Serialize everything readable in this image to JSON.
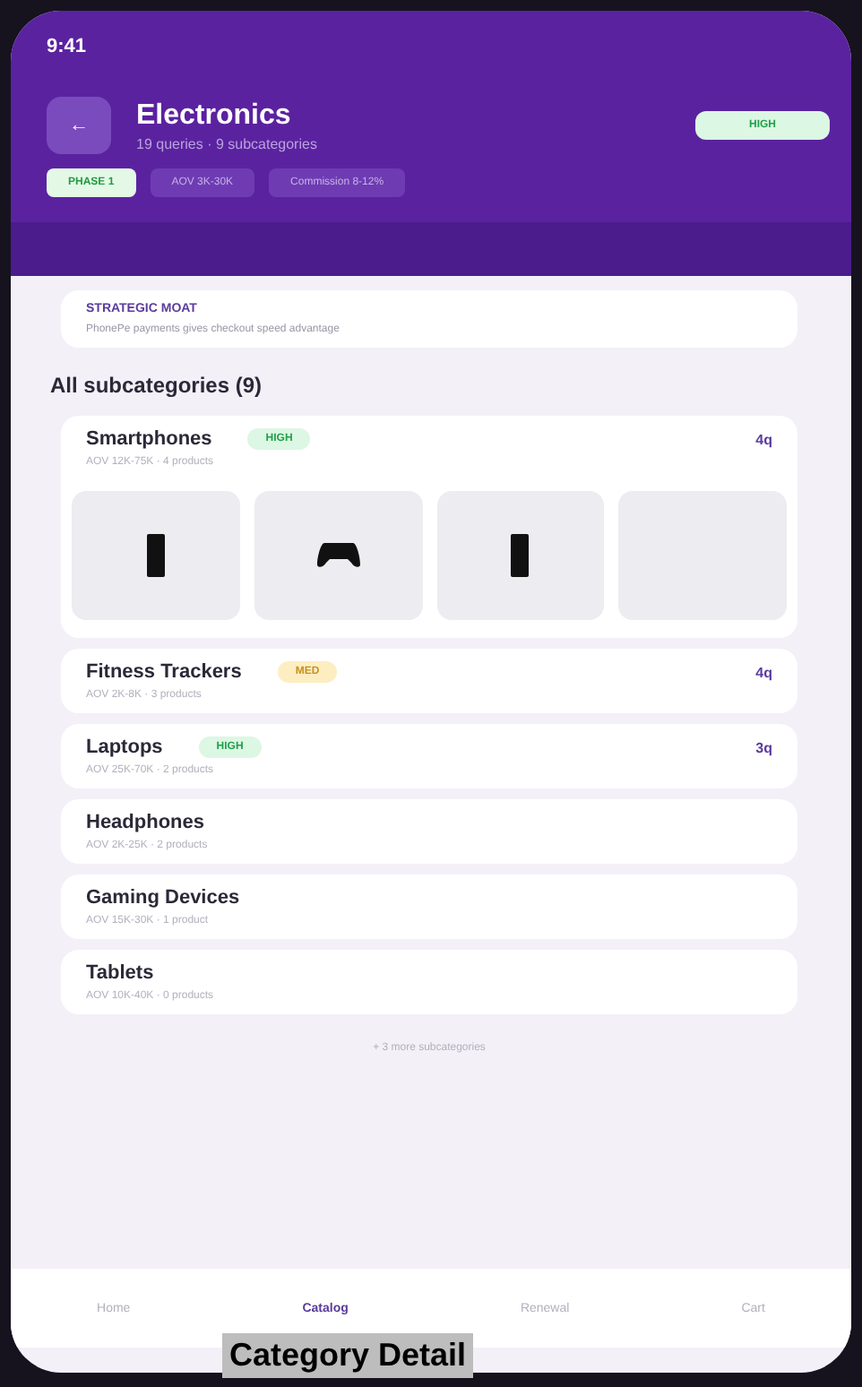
{
  "status_bar": {
    "time": "9:41"
  },
  "header": {
    "back": "←",
    "title": "Electronics",
    "subtitle": "19 queries · 9 subcategories",
    "badge": {
      "label": "HIGH",
      "kind": "high"
    },
    "chips": [
      {
        "label": "PHASE 1",
        "selected": true
      },
      {
        "label": "AOV 3K-30K",
        "selected": false
      },
      {
        "label": "Commission 8-12%",
        "selected": false
      }
    ]
  },
  "moat": {
    "title": "STRATEGIC MOAT",
    "text": "PhonePe payments gives checkout speed advantage"
  },
  "section_title": "All subcategories (9)",
  "subcategories": [
    {
      "name": "Smartphones",
      "badge": {
        "label": "HIGH",
        "kind": "high"
      },
      "meta": "AOV 12K-75K · 4 products",
      "count": "4q",
      "expanded": true,
      "products": [
        {
          "kind": "phone"
        },
        {
          "kind": "gamepad"
        },
        {
          "kind": "phone"
        },
        {
          "kind": "empty"
        }
      ]
    },
    {
      "name": "Fitness Trackers",
      "badge": {
        "label": "MED",
        "kind": "med"
      },
      "meta": "AOV 2K-8K · 3 products",
      "count": "4q",
      "expanded": false
    },
    {
      "name": "Laptops",
      "badge": {
        "label": "HIGH",
        "kind": "high"
      },
      "meta": "AOV 25K-70K · 2 products",
      "count": "3q",
      "expanded": false
    },
    {
      "name": "Headphones",
      "meta": "AOV 2K-25K · 2 products",
      "expanded": false
    },
    {
      "name": "Gaming Devices",
      "meta": "AOV 15K-30K · 1 product",
      "expanded": false
    },
    {
      "name": "Tablets",
      "meta": "AOV 10K-40K · 0 products",
      "expanded": false
    }
  ],
  "more": "+ 3 more subcategories",
  "nav": [
    {
      "label": "Home",
      "selected": false
    },
    {
      "label": "Catalog",
      "selected": true
    },
    {
      "label": "Renewal",
      "selected": false
    },
    {
      "label": "Cart",
      "selected": false
    }
  ],
  "caption": "Category Detail"
}
